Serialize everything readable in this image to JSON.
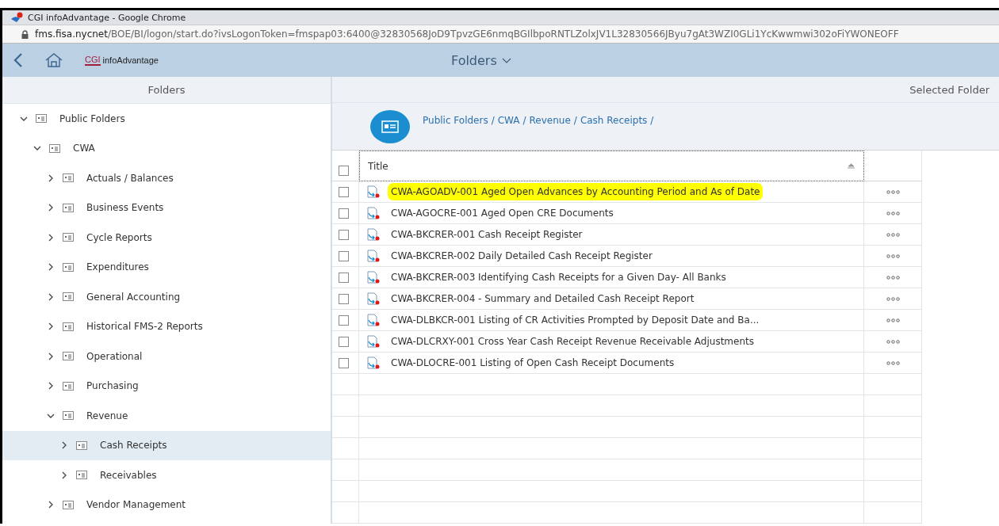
{
  "browser": {
    "title": "CGI infoAdvantage - Google Chrome",
    "url_host": "fms.fisa.nycnet",
    "url_path": "/BOE/BI/logon/start.do?ivsLogonToken=fmspap03:6400@32830568JoD9TpvzGE6nmqBGIlbpoRNTLZolxJV1L32830566JByu7gAt3WZI0GLi1YcKwwmwi302oFiYWONEOFF"
  },
  "header": {
    "logo_mark": "CGI",
    "logo_text": "infoAdvantage",
    "title": "Folders"
  },
  "left_panel": {
    "title": "Folders"
  },
  "right_panel": {
    "title": "Selected Folder"
  },
  "tree": [
    {
      "label": "Public Folders",
      "expanded": true,
      "selected": false,
      "children": [
        {
          "label": "CWA",
          "expanded": true,
          "selected": false,
          "children": [
            {
              "label": "Actuals / Balances",
              "expanded": false,
              "selected": false
            },
            {
              "label": "Business Events",
              "expanded": false,
              "selected": false
            },
            {
              "label": "Cycle Reports",
              "expanded": false,
              "selected": false
            },
            {
              "label": "Expenditures",
              "expanded": false,
              "selected": false
            },
            {
              "label": "General Accounting",
              "expanded": false,
              "selected": false
            },
            {
              "label": "Historical FMS-2 Reports",
              "expanded": false,
              "selected": false
            },
            {
              "label": "Operational",
              "expanded": false,
              "selected": false
            },
            {
              "label": "Purchasing",
              "expanded": false,
              "selected": false
            },
            {
              "label": "Revenue",
              "expanded": true,
              "selected": false,
              "children": [
                {
                  "label": "Cash Receipts",
                  "expanded": false,
                  "selected": true
                },
                {
                  "label": "Receivables",
                  "expanded": false,
                  "selected": false
                }
              ]
            },
            {
              "label": "Vendor Management",
              "expanded": false,
              "selected": false
            }
          ]
        }
      ]
    }
  ],
  "breadcrumb": [
    {
      "label": "Public Folders",
      "separator": "/"
    },
    {
      "label": "CWA",
      "separator": "/"
    },
    {
      "label": "Revenue",
      "separator": "/"
    },
    {
      "label": "Cash Receipts",
      "separator": "/"
    }
  ],
  "table": {
    "columns": [
      "Title"
    ],
    "select_all_checked": false,
    "rows": [
      {
        "title": "CWA-AGOADV-001 Aged Open Advances by Accounting Period and As of Date",
        "checked": false,
        "highlighted": true
      },
      {
        "title": "CWA-AGOCRE-001 Aged Open CRE Documents",
        "checked": false,
        "highlighted": false
      },
      {
        "title": "CWA-BKCRER-001 Cash Receipt Register",
        "checked": false,
        "highlighted": false
      },
      {
        "title": "CWA-BKCRER-002 Daily Detailed Cash Receipt Register",
        "checked": false,
        "highlighted": false
      },
      {
        "title": "CWA-BKCRER-003 Identifying Cash Receipts for a Given Day- All Banks",
        "checked": false,
        "highlighted": false
      },
      {
        "title": "CWA-BKCRER-004 - Summary and Detailed Cash Receipt Report",
        "checked": false,
        "highlighted": false
      },
      {
        "title": "CWA-DLBKCR-001 Listing of CR Activities Prompted by Deposit Date and Ba...",
        "checked": false,
        "highlighted": false
      },
      {
        "title": "CWA-DLCRXY-001 Cross Year Cash Receipt Revenue Receivable Adjustments",
        "checked": false,
        "highlighted": false
      },
      {
        "title": "CWA-DLOCRE-001 Listing of Open Cash Receipt Documents",
        "checked": false,
        "highlighted": false
      }
    ]
  }
}
